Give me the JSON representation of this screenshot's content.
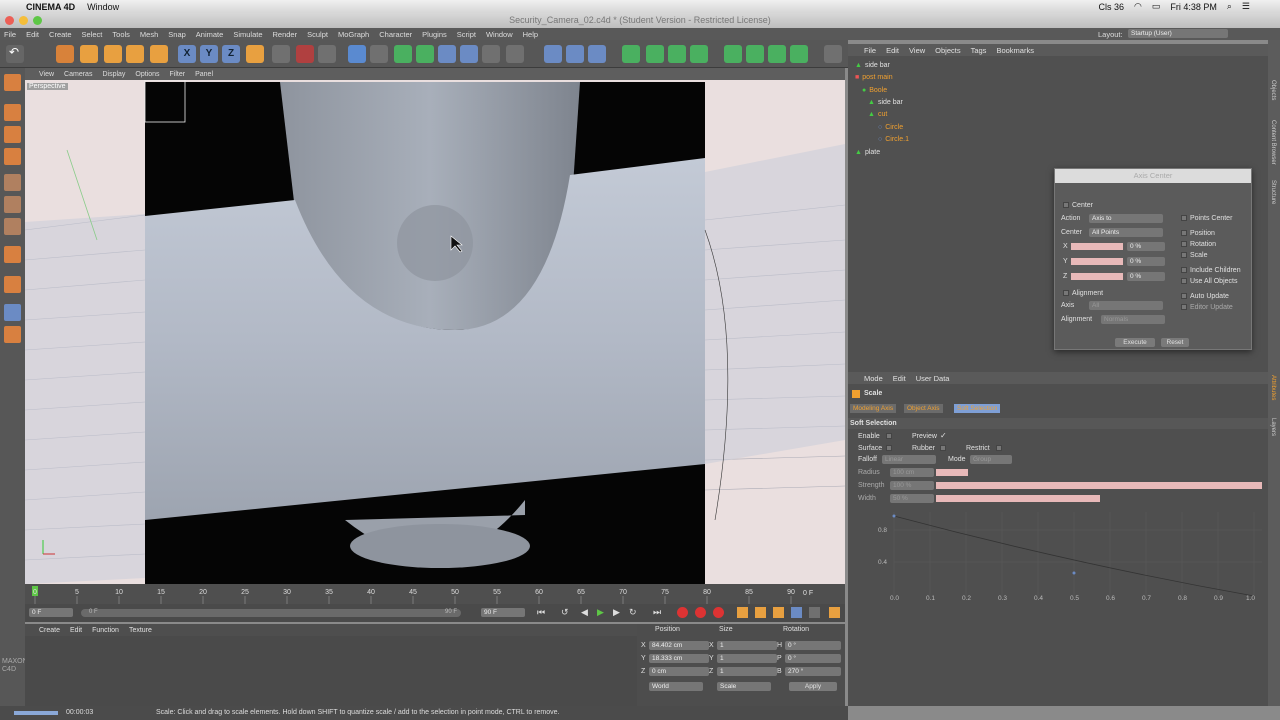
{
  "mac": {
    "apple": "",
    "app": "CINEMA 4D",
    "menu": "Window",
    "clock": "Fri 4:38 PM",
    "status": "Cls 36"
  },
  "window": {
    "title": "Security_Camera_02.c4d * (Student Version - Restricted License)"
  },
  "app_menu": [
    "File",
    "Edit",
    "Create",
    "Select",
    "Tools",
    "Mesh",
    "Snap",
    "Animate",
    "Simulate",
    "Render",
    "Sculpt",
    "MoGraph",
    "Character",
    "Plugins",
    "Script",
    "Window",
    "Help"
  ],
  "layout": {
    "label": "Layout:",
    "value": "Startup (User)"
  },
  "viewport": {
    "menu": [
      "View",
      "Cameras",
      "Display",
      "Options",
      "Filter",
      "Panel"
    ],
    "label": "Perspective"
  },
  "timeline": {
    "ticks": [
      "0",
      "5",
      "10",
      "15",
      "20",
      "25",
      "30",
      "35",
      "40",
      "45",
      "50",
      "55",
      "60",
      "65",
      "70",
      "75",
      "80",
      "85",
      "90"
    ],
    "end_frame": "0 F",
    "start": "0 F",
    "inner": "0 F",
    "max": "90 F",
    "max2": "90 F"
  },
  "material": {
    "menu": [
      "Create",
      "Edit",
      "Function",
      "Texture"
    ]
  },
  "coords": {
    "headers": [
      "Position",
      "Size",
      "Rotation"
    ],
    "rows": [
      {
        "a": "X",
        "pos": "84.402 cm",
        "b": "X",
        "size": "1",
        "c": "H",
        "rot": "0 °"
      },
      {
        "a": "Y",
        "pos": "18.333 cm",
        "b": "Y",
        "size": "1",
        "c": "P",
        "rot": "0 °"
      },
      {
        "a": "Z",
        "pos": "0 cm",
        "b": "Z",
        "size": "1",
        "c": "B",
        "rot": "270 °"
      }
    ],
    "mode1": "World",
    "mode2": "Scale",
    "apply": "Apply"
  },
  "status": {
    "time": "00:00:03",
    "message": "Scale: Click and drag to scale elements. Hold down SHIFT to quantize scale / add to the selection in point mode, CTRL to remove."
  },
  "objects": {
    "menu": [
      "File",
      "Edit",
      "View",
      "Objects",
      "Tags",
      "Bookmarks"
    ],
    "items": [
      "side bar",
      "post main",
      "Boole",
      "side bar",
      "cut",
      "Circle",
      "Circle.1",
      "plate"
    ]
  },
  "axis_dialog": {
    "title": "Axis Center",
    "center": "Center",
    "action_label": "Action",
    "action": "Axis to",
    "center_label": "Center",
    "center_val": "All Points",
    "x": "X",
    "y": "Y",
    "z": "Z",
    "xval": "0 %",
    "yval": "0 %",
    "zval": "0 %",
    "alignment": "Alignment",
    "axis_label": "Axis",
    "axis_val": "All",
    "align_label": "Alignment",
    "align_val": "Normals",
    "points_center": "Points Center",
    "position": "Position",
    "rotation": "Rotation",
    "scale": "Scale",
    "include_children": "Include Children",
    "use_all": "Use All Objects",
    "auto_update": "Auto Update",
    "editor_update": "Editor Update",
    "execute": "Execute",
    "reset": "Reset"
  },
  "attributes": {
    "menu": [
      "Mode",
      "Edit",
      "User Data"
    ],
    "tool": "Scale",
    "tabs": [
      "Modeling Axis",
      "Object Axis",
      "Soft Selection"
    ],
    "section": "Soft Selection",
    "enable": "Enable",
    "preview": "Preview",
    "surface": "Surface",
    "rubber": "Rubber",
    "restrict": "Restrict",
    "falloff": "Falloff",
    "falloff_val": "Linear",
    "mode": "Mode",
    "mode_val": "Group",
    "radius": "Radius",
    "radius_val": "100 cm",
    "strength": "Strength",
    "strength_val": "100 %",
    "width": "Width",
    "width_val": "50 %",
    "graph_y": [
      "0.8",
      "0.4"
    ],
    "graph_x": [
      "0.0",
      "0.1",
      "0.2",
      "0.3",
      "0.4",
      "0.5",
      "0.6",
      "0.7",
      "0.8",
      "0.9",
      "1.0"
    ]
  },
  "side_tabs": [
    "Objects",
    "Content Browser",
    "Structure",
    "Attributes",
    "Layers"
  ],
  "colors": {
    "accent": "#f0a030",
    "selected_tab": "#7e9fd6"
  }
}
